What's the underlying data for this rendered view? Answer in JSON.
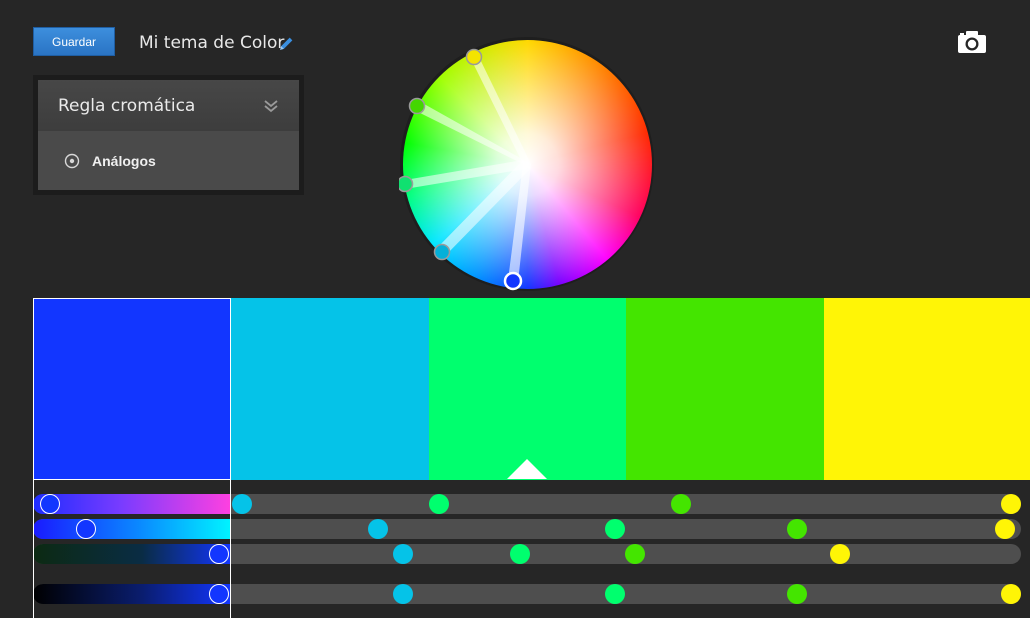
{
  "toolbar": {
    "save_label": "Guardar",
    "theme_title": "Mi tema de Color",
    "edit_icon": "pencil-icon",
    "capture_icon": "camera-icon"
  },
  "rule_panel": {
    "title": "Regla cromática",
    "collapse_icon": "double-chevron-down-icon",
    "selected_rule": "Análogos",
    "radio_icon": "radio-button-icon"
  },
  "swatches": [
    {
      "color": "#1236FF",
      "selected": true
    },
    {
      "color": "#05C3E8",
      "selected": false
    },
    {
      "color": "#00FF6E",
      "selected": false,
      "base": true
    },
    {
      "color": "#44E500",
      "selected": false
    },
    {
      "color": "#FFF506",
      "selected": false
    }
  ],
  "colors": {
    "background": "#262626",
    "accent": "#2a74c4"
  }
}
